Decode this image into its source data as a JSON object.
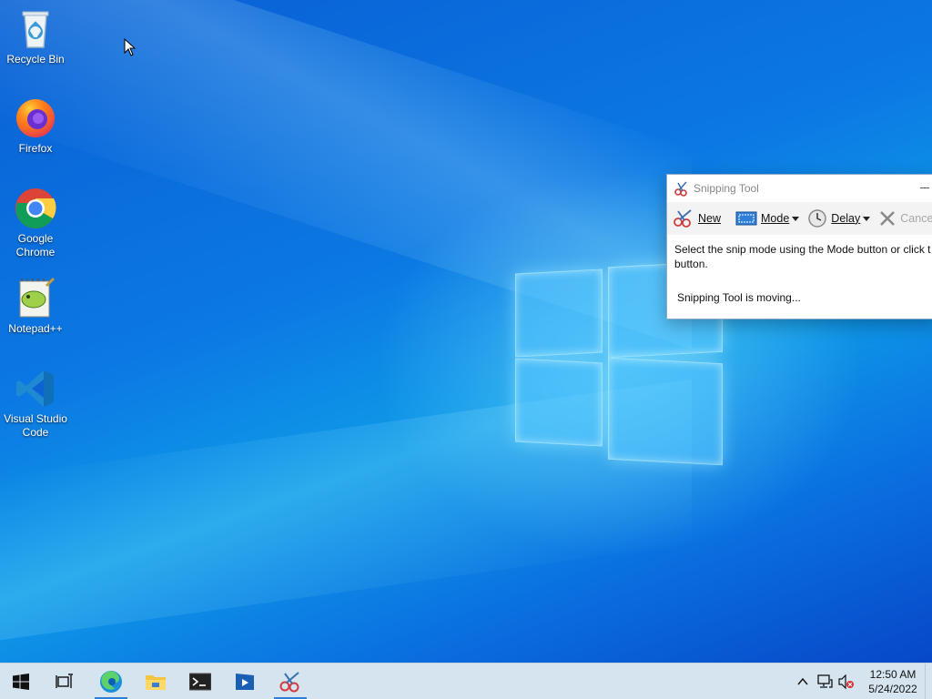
{
  "desktop": {
    "icons": [
      {
        "label": "Recycle Bin",
        "icon": "recycle-bin-icon"
      },
      {
        "label": "Firefox",
        "icon": "firefox-icon"
      },
      {
        "label": "Google Chrome",
        "icon": "chrome-icon"
      },
      {
        "label": "Notepad++",
        "icon": "notepad-plus-plus-icon"
      },
      {
        "label": "Visual Studio Code",
        "icon": "vscode-icon"
      }
    ]
  },
  "snipping_tool": {
    "title": "Snipping Tool",
    "toolbar": {
      "new_label": "New",
      "mode_label": "Mode",
      "delay_label": "Delay",
      "cancel_label": "Cancel"
    },
    "instructions": "Select the snip mode using the Mode button or click the New button.",
    "instructions_line1": "Select the snip mode using the Mode button or click t",
    "instructions_line2": "button.",
    "status": "Snipping Tool is moving..."
  },
  "taskbar": {
    "items": [
      {
        "name": "start",
        "icon": "windows-start-icon"
      },
      {
        "name": "task-view",
        "icon": "task-view-icon"
      },
      {
        "name": "edge",
        "icon": "edge-icon",
        "active": true
      },
      {
        "name": "file-explorer",
        "icon": "folder-icon"
      },
      {
        "name": "terminal",
        "icon": "terminal-icon"
      },
      {
        "name": "media-player",
        "icon": "media-player-icon"
      },
      {
        "name": "snipping-tool",
        "icon": "snipping-tool-icon",
        "active": true
      }
    ],
    "clock": {
      "time": "12:50 AM",
      "date": "5/24/2022"
    }
  },
  "colors": {
    "taskbar_bg": "#d6e4f0",
    "accent": "#2e7fd8",
    "desktop_blue": "#0b78e3"
  }
}
